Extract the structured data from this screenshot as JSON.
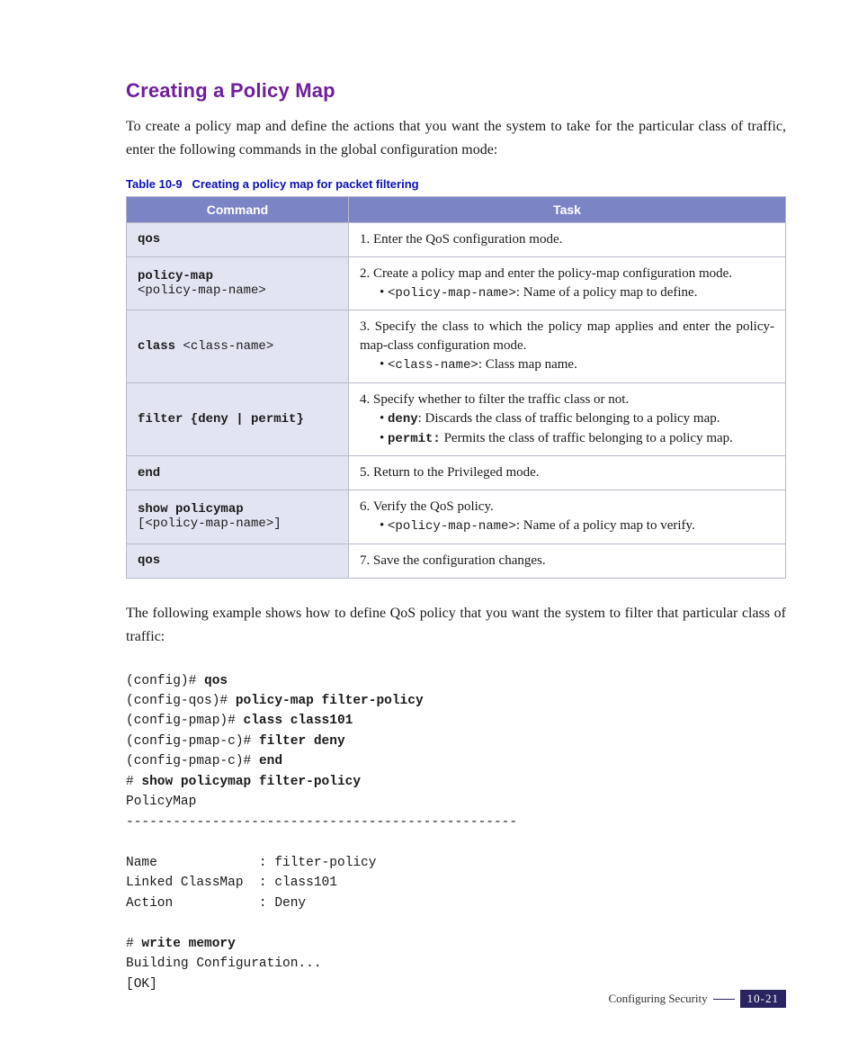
{
  "heading": "Creating a Policy Map",
  "intro": "To create a policy map and define the actions that you want the system to take for the particular class of traffic, enter the following commands in the global configuration mode:",
  "table": {
    "caption_num": "Table 10-9",
    "caption_text": "Creating a policy map for packet filtering",
    "head_cmd": "Command",
    "head_task": "Task",
    "rows": {
      "r1": {
        "cmd": "qos",
        "task": "1. Enter the QoS configuration mode."
      },
      "r2": {
        "cmd_bold": "policy-map",
        "cmd_arg": "<policy-map-name>",
        "task": "2. Create a policy map and enter the policy-map configuration mode.",
        "sub_mono": "<policy-map-name>",
        "sub_text": ": Name of a policy map to define."
      },
      "r3": {
        "cmd_bold": "class ",
        "cmd_arg": "<class-name>",
        "task": "3. Specify the class to which the policy map applies and enter the policy-map-class configuration mode.",
        "sub_mono": "<class-name>",
        "sub_text": ": Class map name."
      },
      "r4": {
        "cmd": "filter {deny | permit}",
        "task": "4. Specify whether to filter the traffic class or not.",
        "sub1_b": "deny",
        "sub1_t": ": Discards the class of traffic belonging to a policy map.",
        "sub2_b": "permit:",
        "sub2_t": " Permits the class of traffic belonging to a policy map."
      },
      "r5": {
        "cmd": "end",
        "task": "5. Return to the Privileged mode."
      },
      "r6": {
        "cmd_bold": "show policymap",
        "cmd_arg": "[<policy-map-name>]",
        "task": "6. Verify the QoS policy.",
        "sub_mono": "<policy-map-name>",
        "sub_text": ": Name of a policy map to verify."
      },
      "r7": {
        "cmd": "qos",
        "task": "7. Save the configuration changes."
      }
    }
  },
  "outro": "The following example shows how to define QoS policy that you want the system to filter that particular class of traffic:",
  "example": {
    "l1p": "(config)# ",
    "l1b": "qos",
    "l2p": "(config-qos)# ",
    "l2b": "policy-map filter-policy",
    "l3p": "(config-pmap)# ",
    "l3b": "class class101",
    "l4p": "(config-pmap-c)# ",
    "l4b": "filter deny",
    "l5p": "(config-pmap-c)# ",
    "l5b": "end",
    "l6p": "# ",
    "l6b": "show policymap filter-policy",
    "l7": "PolicyMap",
    "l8": "--------------------------------------------------",
    "l9": "",
    "l10": "Name             : filter-policy",
    "l11": "Linked ClassMap  : class101",
    "l12": "Action           : Deny",
    "l13": "",
    "l14p": "# ",
    "l14b": "write memory",
    "l15": "Building Configuration...",
    "l16": "[OK]"
  },
  "footer": {
    "section": "Configuring Security",
    "page": "10-21"
  }
}
